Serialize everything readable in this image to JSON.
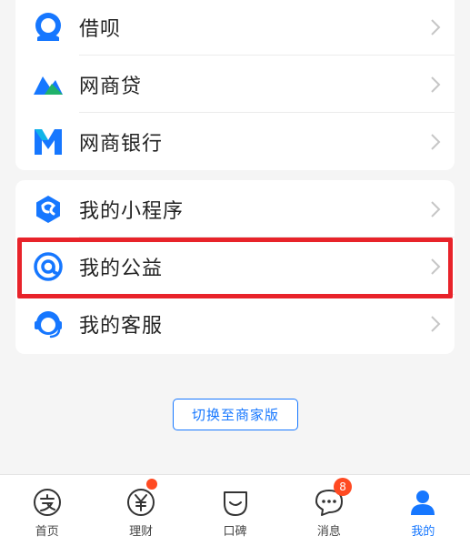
{
  "colors": {
    "accent": "#1677ff",
    "highlight": "#e8232a",
    "badge": "#ff4a22",
    "background": "#f5f5f5"
  },
  "section1": {
    "items": [
      {
        "label": "借呗",
        "icon": "jiebei-icon"
      },
      {
        "label": "网商贷",
        "icon": "wangshangdai-icon"
      },
      {
        "label": "网商银行",
        "icon": "mybank-icon"
      }
    ]
  },
  "section2": {
    "items": [
      {
        "label": "我的小程序",
        "icon": "mini-program-icon"
      },
      {
        "label": "我的公益",
        "icon": "charity-icon",
        "highlighted": true
      },
      {
        "label": "我的客服",
        "icon": "customer-service-icon"
      }
    ]
  },
  "merchant_button": {
    "label": "切换至商家版"
  },
  "tabbar": {
    "tabs": [
      {
        "label": "首页",
        "icon": "alipay-home-icon"
      },
      {
        "label": "理财",
        "icon": "yuan-icon",
        "dot": true
      },
      {
        "label": "口碑",
        "icon": "koubei-icon"
      },
      {
        "label": "消息",
        "icon": "message-icon",
        "badge": "8"
      },
      {
        "label": "我的",
        "icon": "person-icon",
        "active": true
      }
    ]
  }
}
